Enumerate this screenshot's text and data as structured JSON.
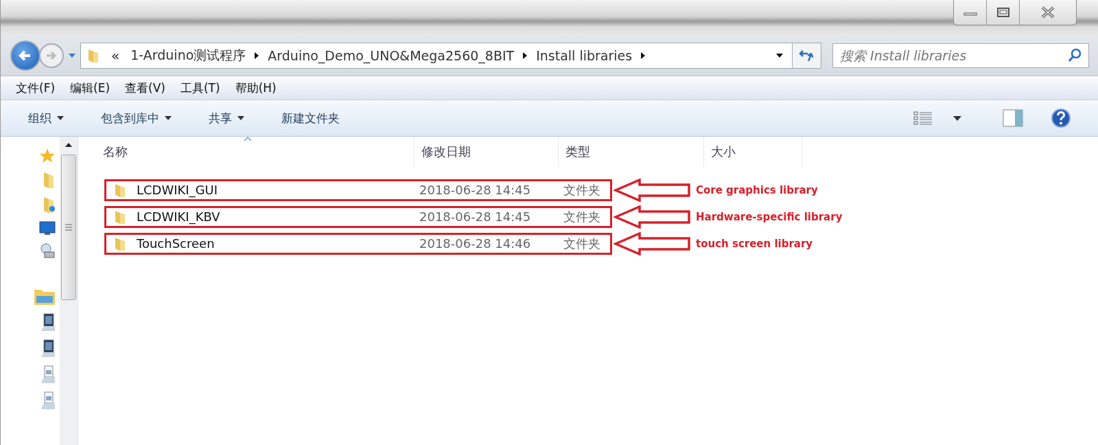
{
  "address_bar": {
    "overflow": "«",
    "crumbs": [
      "1-Arduino测试程序",
      "Arduino_Demo_UNO&Mega2560_8BIT",
      "Install libraries"
    ]
  },
  "search": {
    "placeholder": "搜索 Install libraries"
  },
  "menu": [
    "文件(F)",
    "编辑(E)",
    "查看(V)",
    "工具(T)",
    "帮助(H)"
  ],
  "toolbar": [
    {
      "label": "组织",
      "dropdown": true
    },
    {
      "label": "包含到库中",
      "dropdown": true
    },
    {
      "label": "共享",
      "dropdown": true
    },
    {
      "label": "新建文件夹",
      "dropdown": false
    }
  ],
  "columns": [
    {
      "label": "名称",
      "sorted": true
    },
    {
      "label": "修改日期",
      "sorted": false
    },
    {
      "label": "类型",
      "sorted": false
    },
    {
      "label": "大小",
      "sorted": false
    }
  ],
  "rows": [
    {
      "name": "LCDWIKI_GUI",
      "date": "2018-06-28 14:45",
      "type": "文件夹",
      "annotation": "Core graphics library"
    },
    {
      "name": "LCDWIKI_KBV",
      "date": "2018-06-28 14:45",
      "type": "文件夹",
      "annotation": "Hardware-specific library"
    },
    {
      "name": "TouchScreen",
      "date": "2018-06-28 14:46",
      "type": "文件夹",
      "annotation": "touch screen library"
    }
  ]
}
